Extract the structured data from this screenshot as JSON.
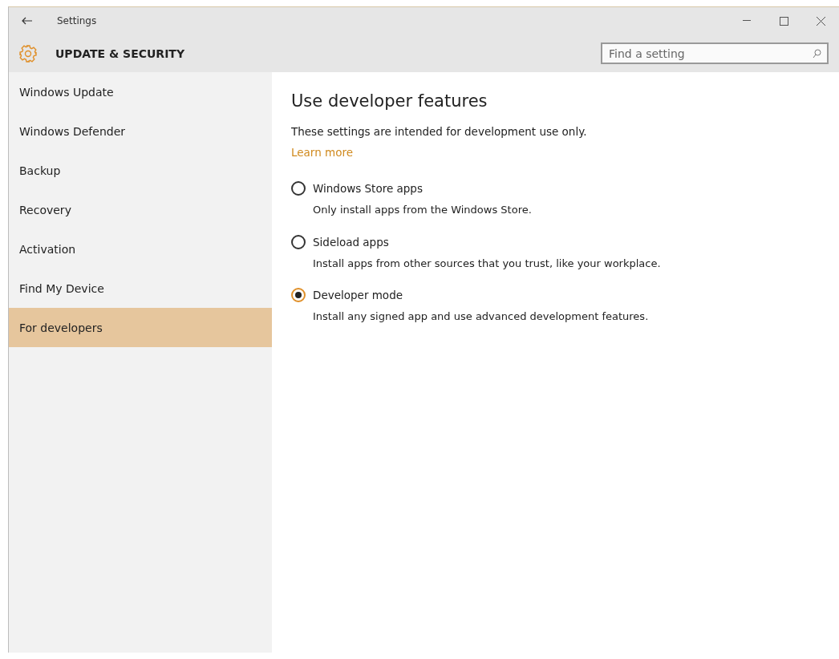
{
  "window": {
    "title": "Settings"
  },
  "header": {
    "title": "UPDATE & SECURITY"
  },
  "search": {
    "placeholder": "Find a setting"
  },
  "sidebar": {
    "items": [
      {
        "label": "Windows Update",
        "selected": false
      },
      {
        "label": "Windows Defender",
        "selected": false
      },
      {
        "label": "Backup",
        "selected": false
      },
      {
        "label": "Recovery",
        "selected": false
      },
      {
        "label": "Activation",
        "selected": false
      },
      {
        "label": "Find My Device",
        "selected": false
      },
      {
        "label": "For developers",
        "selected": true
      }
    ]
  },
  "content": {
    "heading": "Use developer features",
    "description": "These settings are intended for development use only.",
    "link": "Learn more",
    "options": [
      {
        "label": "Windows Store apps",
        "description": "Only install apps from the Windows Store.",
        "selected": false
      },
      {
        "label": "Sideload apps",
        "description": "Install apps from other sources that you trust, like your workplace.",
        "selected": false
      },
      {
        "label": "Developer mode",
        "description": "Install any signed app and use advanced development features.",
        "selected": true
      }
    ]
  }
}
